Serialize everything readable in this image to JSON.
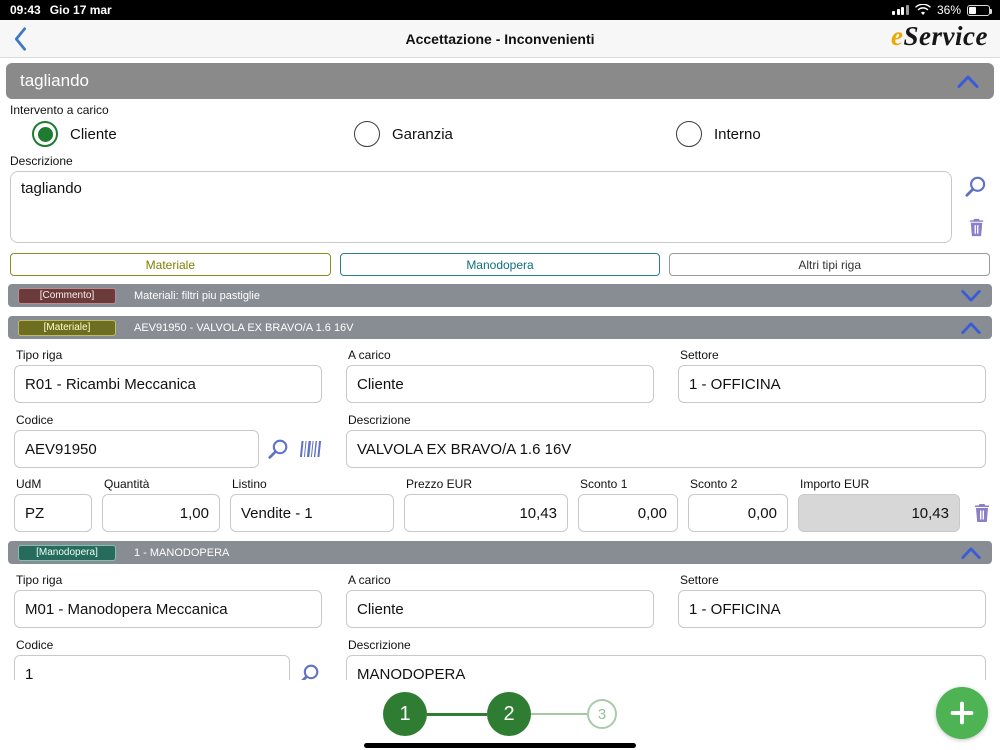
{
  "colors": {
    "accent_blue": "#3a5bd9",
    "icon_search_purple": "#5f72c4",
    "icon_trash_purple": "#8a7fc8",
    "radio_green": "#1e7b30",
    "step_green": "#2e7d32",
    "fab_green": "#4db353",
    "olive": "#7f7f00",
    "teal": "#0d6e7e",
    "commento_red": "#6b3a3a",
    "logo_gold": "#eda900",
    "bar_gray": "#888c93"
  },
  "icons": {
    "back": "chevron-left-icon",
    "collapse": "chevron-up-icon",
    "expand": "chevron-down-icon",
    "search": "magnifier-icon",
    "barcode": "barcode-icon",
    "delete": "trash-icon",
    "add": "plus-icon",
    "signal": "cellular-signal-icon",
    "wifi": "wifi-icon",
    "battery": "battery-icon"
  },
  "status_bar": {
    "time": "09:43",
    "date": "Gio 17 mar",
    "battery_percent": "36%"
  },
  "nav": {
    "title": "Accettazione - Inconvenienti",
    "logo_e": "e",
    "logo_service": "Service"
  },
  "section": {
    "title": "tagliando"
  },
  "intervento": {
    "label": "Intervento a carico",
    "options": [
      {
        "label": "Cliente",
        "selected": true
      },
      {
        "label": "Garanzia",
        "selected": false
      },
      {
        "label": "Interno",
        "selected": false
      }
    ]
  },
  "descrizione_box": {
    "label": "Descrizione",
    "value": "tagliando"
  },
  "type_buttons": {
    "materiale": "Materiale",
    "manodopera": "Manodopera",
    "altri": "Altri tipi riga"
  },
  "commento_row": {
    "badge": "[Commento]",
    "title": "Materiali: filtri piu pastiglie"
  },
  "materiale_row": {
    "badge": "[Materiale]",
    "title": "AEV91950 - VALVOLA EX BRAVO/A 1.6 16V"
  },
  "materiale_form": {
    "labels": {
      "tipo_riga": "Tipo riga",
      "a_carico": "A carico",
      "settore": "Settore",
      "codice": "Codice",
      "descrizione": "Descrizione",
      "udm": "UdM",
      "quantita": "Quantità",
      "listino": "Listino",
      "prezzo": "Prezzo EUR",
      "sconto1": "Sconto 1",
      "sconto2": "Sconto 2",
      "importo": "Importo EUR"
    },
    "values": {
      "tipo_riga": "R01 - Ricambi Meccanica",
      "a_carico": "Cliente",
      "settore": "1 - OFFICINA",
      "codice": "AEV91950",
      "descrizione": "VALVOLA EX BRAVO/A 1.6 16V",
      "udm": "PZ",
      "quantita": "1,00",
      "listino": "Vendite - 1",
      "prezzo": "10,43",
      "sconto1": "0,00",
      "sconto2": "0,00",
      "importo": "10,43"
    }
  },
  "manodopera_row": {
    "badge": "[Manodopera]",
    "title": "1 - MANODOPERA"
  },
  "manodopera_form": {
    "labels": {
      "tipo_riga": "Tipo riga",
      "a_carico": "A carico",
      "settore": "Settore",
      "codice": "Codice",
      "descrizione": "Descrizione"
    },
    "values": {
      "tipo_riga": "M01 - Manodopera Meccanica",
      "a_carico": "Cliente",
      "settore": "1 - OFFICINA",
      "codice": "1",
      "descrizione": "MANODOPERA"
    }
  },
  "stepper": {
    "steps": [
      "1",
      "2",
      "3"
    ]
  }
}
